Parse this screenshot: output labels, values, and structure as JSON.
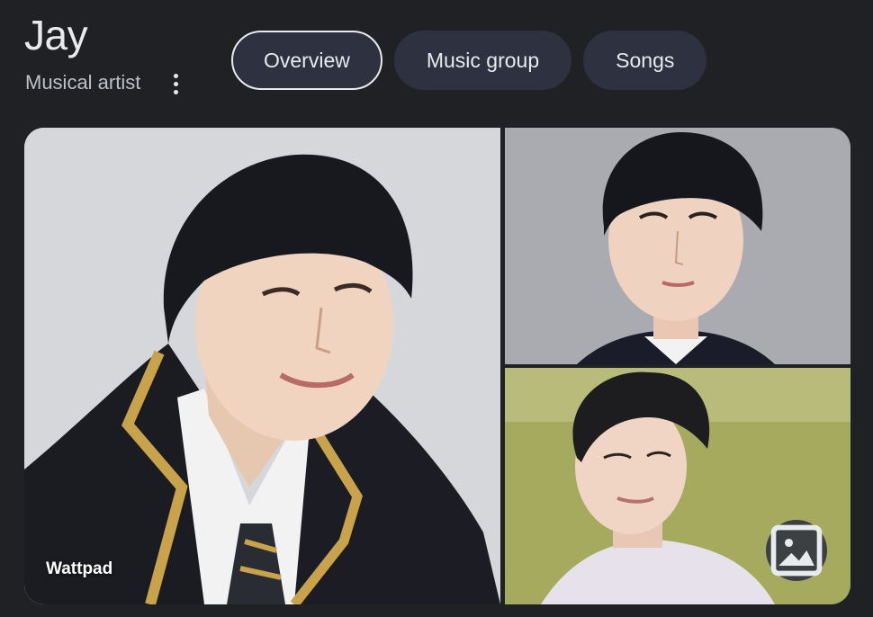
{
  "entity": {
    "name": "Jay",
    "type": "Musical artist"
  },
  "chips": [
    {
      "label": "Overview",
      "selected": true
    },
    {
      "label": "Music group",
      "selected": false
    },
    {
      "label": "Songs",
      "selected": false
    }
  ],
  "gallery": {
    "source_label": "Wattpad",
    "images_button_icon": "image-icon"
  },
  "more_icon": "more-vert-icon"
}
